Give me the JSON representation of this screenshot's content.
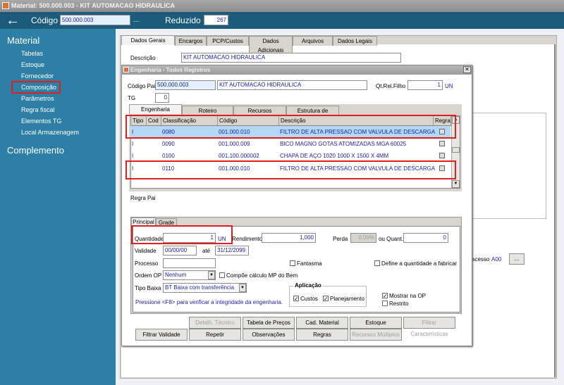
{
  "window": {
    "title": "Material: 500.000.003 - KIT  AUTOMACAO HIDRAULICA"
  },
  "header": {
    "codigo_label": "Código",
    "codigo_value": "500.000.003",
    "ellipsis": "...",
    "reduzido_label": "Reduzido",
    "reduzido_value": "267"
  },
  "sidebar": {
    "section1": "Material",
    "items": [
      "Tabelas",
      "Estoque",
      "Fornecedor",
      "Composição",
      "Parâmetros",
      "Regra fiscal",
      "Elementos TG",
      "Local Armazenagem"
    ],
    "section2": "Complemento"
  },
  "main": {
    "tabs": [
      "Dados Gerais",
      "Encargos",
      "PCP/Custos",
      "Dados Adicionais",
      "Arquivos",
      "Dados Legais"
    ],
    "descricao_label": "Descrição",
    "descricao_value": "KIT  AUTOMACAO HIDRAULICA",
    "acesso_label": "acesso",
    "acesso_value": "A00",
    "more_button": "..."
  },
  "dialog": {
    "title": "Engenharia - Todos Registros",
    "close": "✕",
    "codigo_pai_label": "Código Pai",
    "codigo_pai_value": "500.000.003",
    "codigo_pai_desc": "KIT  AUTOMACAO HIDRAULICA",
    "qt_rel_label": "Qt.Rel.Filho",
    "qt_rel_value": "1",
    "qt_rel_unit": "UN",
    "tg_label": "TG",
    "tg_value": "0",
    "tabs": [
      "Engenharia",
      "Roteiro",
      "Recursos",
      "Estrutura de Produto"
    ],
    "grid": {
      "columns": [
        "Tipo",
        "Cod",
        "Classificação",
        "Código",
        "Descrição",
        "Regra"
      ],
      "rows": [
        {
          "tipo": "I",
          "cod": "",
          "classificacao": "0080",
          "codigo": "001.000.010",
          "descricao": "FILTRO DE ALTA PRESSAO COM VALVULA DE DESCARGA",
          "regra": false,
          "selected": true
        },
        {
          "tipo": "I",
          "cod": "",
          "classificacao": "0090",
          "codigo": "001.000.009",
          "descricao": "BICO MAGNO GOTAS ATOMIZADAS MGA 60025",
          "regra": false
        },
        {
          "tipo": "I",
          "cod": "",
          "classificacao": "0100",
          "codigo": "001.100.000002",
          "descricao": "CHAPA DE AÇO 1020 1000 X 1500  X 4MM",
          "regra": false
        },
        {
          "tipo": "I",
          "cod": "",
          "classificacao": "0110",
          "codigo": "001.000.010",
          "descricao": "FILTRO DE ALTA PRESSAO COM VALVULA DE DESCARGA",
          "regra": false
        }
      ]
    },
    "regra_pai_label": "Regra Pai",
    "sub_tabs": [
      "Principal",
      "Grade"
    ],
    "quantidade_label": "Quantidade",
    "quantidade_value": "1",
    "quantidade_unit": "UN",
    "rendimento_label": "Rendimento",
    "rendimento_value": "1,000",
    "perda_label": "Perda",
    "perda_value": "0,00%",
    "ou_quant_label": "ou Quant.",
    "ou_quant_value": "0",
    "validade_label": "Validade",
    "validade_from": "00/00/00",
    "ate_label": "até",
    "validade_to": "31/12/2099",
    "processo_label": "Processo",
    "processo_value": "",
    "fantasma_label": "Fantasma",
    "define_label": "Define a quantidade a fabricar",
    "ordem_op_label": "Ordem OP",
    "ordem_op_value": "Nenhum",
    "compoe_label": "Compõe cálculo MP do Bem",
    "tipo_baixa_label": "Tipo Baixa",
    "tipo_baixa_value": "BT Baixa com transferência",
    "aplicacao_label": "Aplicação",
    "custos_label": "Custos",
    "planejamento_label": "Planejamento",
    "mostrar_op_label": "Mostrar na OP",
    "restrito_label": "Restrito",
    "hint": "Pressione <F8> para verificar a integridade da engenharia.",
    "buttons_row1": [
      "Detalh. Técnico",
      "Tabela de Preços",
      "Cad. Material",
      "Estoque",
      "Filtrar Características"
    ],
    "buttons_row2": [
      "Filtrar Validade",
      "Repetir",
      "Observações",
      "Regras",
      "Recursos Múltiplos"
    ]
  }
}
